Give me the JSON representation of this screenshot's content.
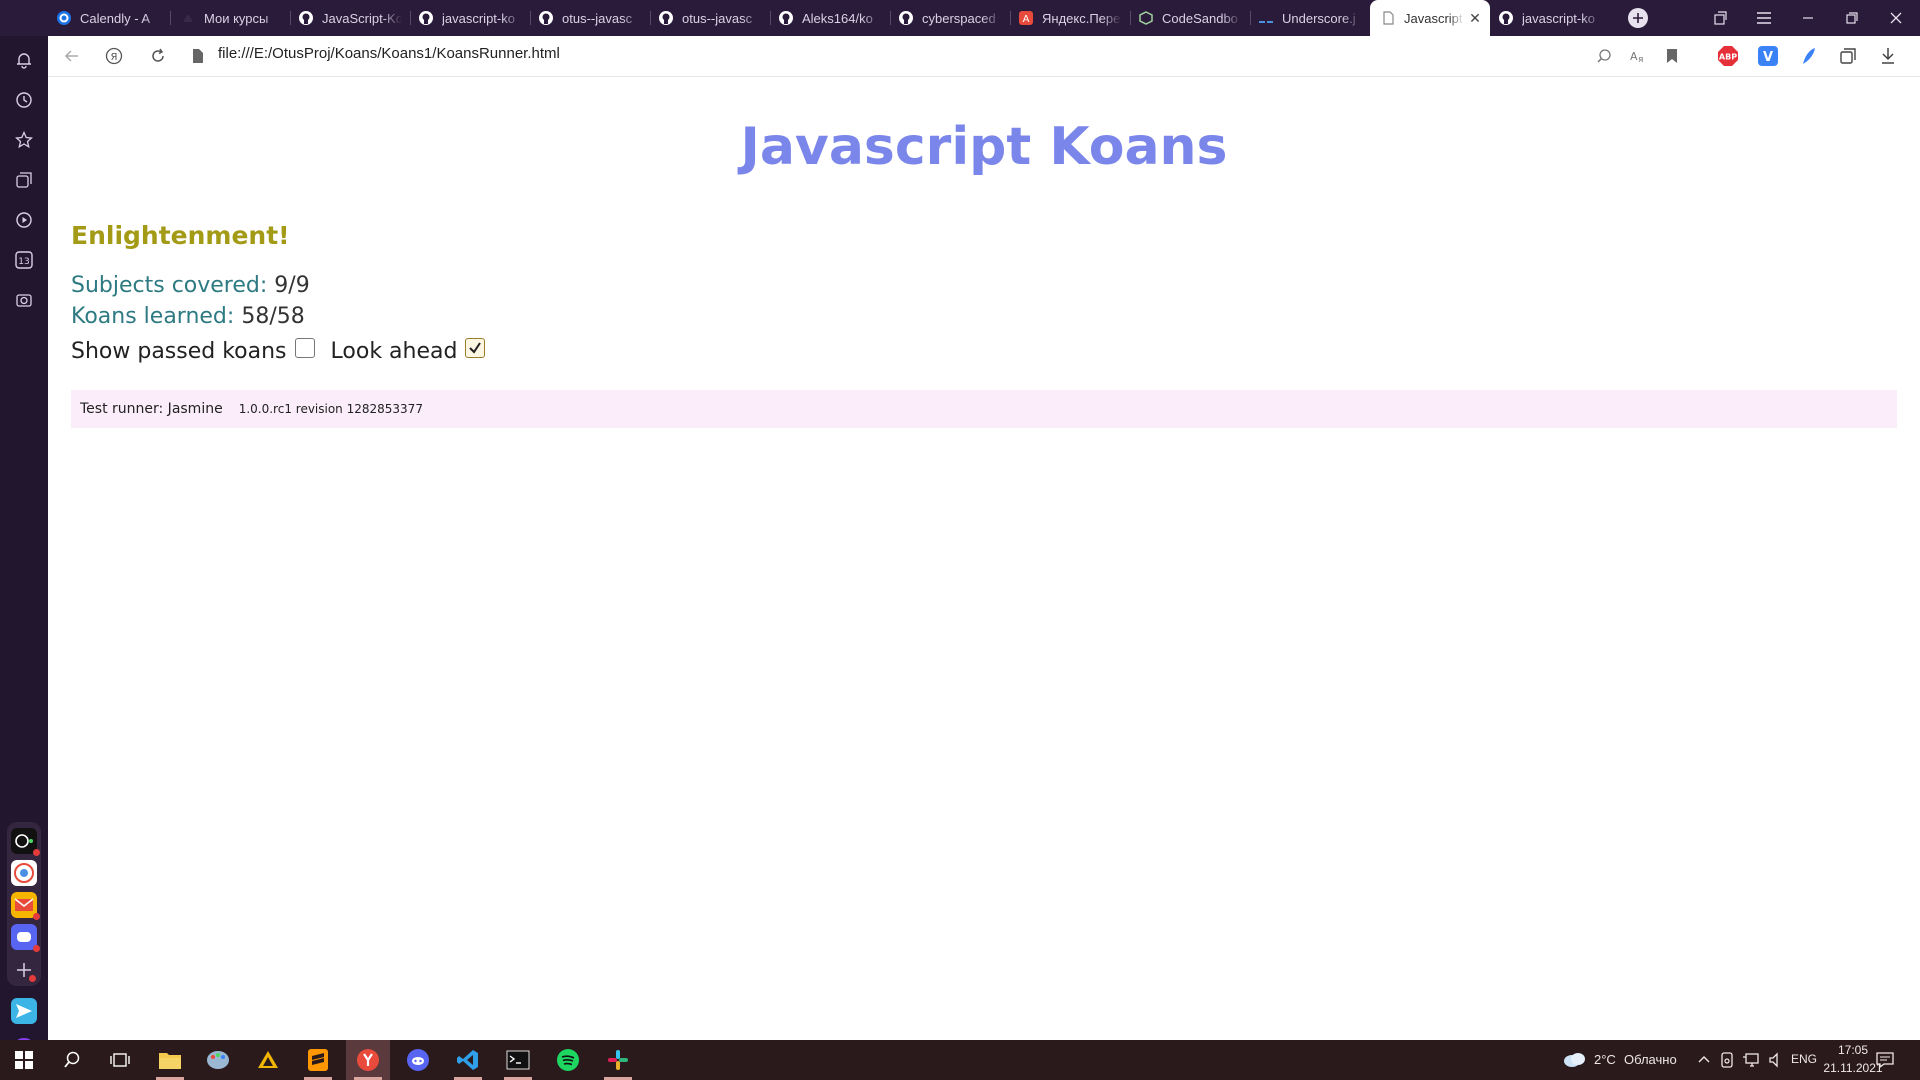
{
  "tabs": [
    {
      "label": "Calendly - A",
      "icon": "calendly-icon"
    },
    {
      "label": "Мои курсы",
      "icon": "courses-icon"
    },
    {
      "label": "JavaScript-Ko",
      "icon": "github-icon"
    },
    {
      "label": "javascript-ko",
      "icon": "github-icon"
    },
    {
      "label": "otus--javasc",
      "icon": "github-icon"
    },
    {
      "label": "otus--javasc",
      "icon": "github-icon"
    },
    {
      "label": "Aleks164/ko",
      "icon": "github-icon"
    },
    {
      "label": "cyberspaced",
      "icon": "github-icon"
    },
    {
      "label": "Яндекс.Пере",
      "icon": "yandex-translate-icon"
    },
    {
      "label": "CodeSandbo",
      "icon": "codesandbox-icon"
    },
    {
      "label": "Underscore.j",
      "icon": "underscore-icon"
    },
    {
      "label": "Javascript",
      "icon": "file-icon",
      "active": true
    },
    {
      "label": "javascript-ko",
      "icon": "github-icon"
    }
  ],
  "address": {
    "url": "file:///E:/OtusProj/Koans/Koans1/KoansRunner.html"
  },
  "extensions": {
    "abp_label": "ABP",
    "v_label": "V"
  },
  "page": {
    "title": "Javascript Koans",
    "status": "Enlightenment!",
    "subjects_label": "Subjects covered:",
    "subjects_value": "9/9",
    "koans_label": "Koans learned:",
    "koans_value": "58/58",
    "show_passed_label": "Show passed koans",
    "show_passed_checked": false,
    "look_ahead_label": "Look ahead",
    "look_ahead_checked": true,
    "runner_label": "Test runner: Jasmine",
    "runner_version": "1.0.0.rc1 revision 1282853377"
  },
  "sidebar": {
    "calendar_badge": "13"
  },
  "taskbar": {
    "weather_temp": "2°C",
    "weather_text": "Облачно",
    "lang": "ENG",
    "time": "17:05",
    "date": "21.11.2021"
  },
  "colors": {
    "title": "#7b86ea",
    "status": "#a39a16",
    "stat_key": "#2e7a82",
    "runner_bg": "#fbeefa",
    "tabbar_bg": "#2b1b3a",
    "taskbar_bg": "#2a1a1c"
  }
}
